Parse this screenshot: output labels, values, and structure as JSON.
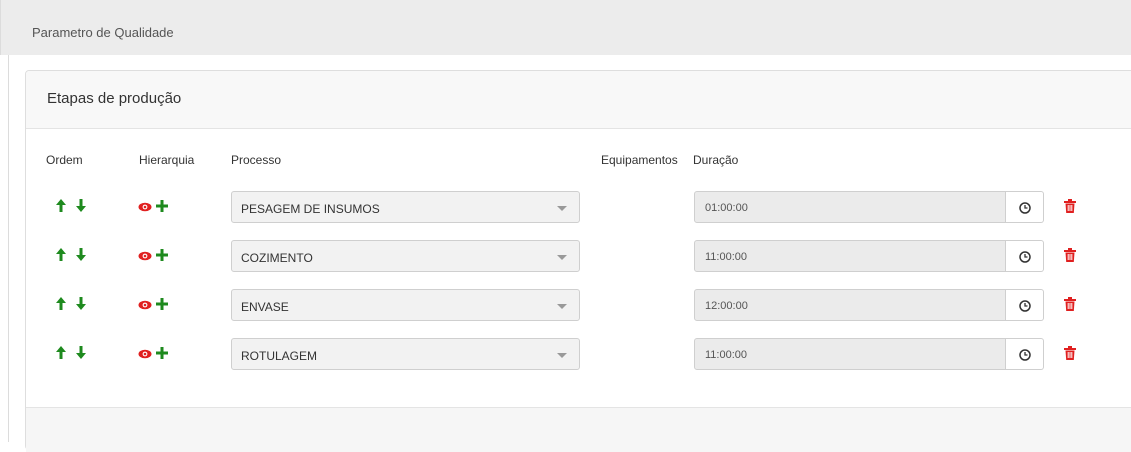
{
  "page": {
    "title": "Parametro de Qualidade"
  },
  "panel": {
    "title": "Etapas de produção",
    "columns": {
      "ordem": "Ordem",
      "hierarquia": "Hierarquia",
      "processo": "Processo",
      "equipamentos": "Equipamentos",
      "duracao": "Duração"
    },
    "rows": [
      {
        "processo": "PESAGEM DE INSUMOS",
        "duracao": "01:00:00"
      },
      {
        "processo": "COZIMENTO",
        "duracao": "11:00:00"
      },
      {
        "processo": "ENVASE",
        "duracao": "12:00:00"
      },
      {
        "processo": "ROTULAGEM",
        "duracao": "11:00:00"
      }
    ]
  },
  "colors": {
    "green": "#1e8a1e",
    "red": "#e02020"
  },
  "icons": [
    "arrow-up-icon",
    "arrow-down-icon",
    "eye-icon",
    "plus-icon",
    "clock-icon",
    "trash-icon"
  ]
}
